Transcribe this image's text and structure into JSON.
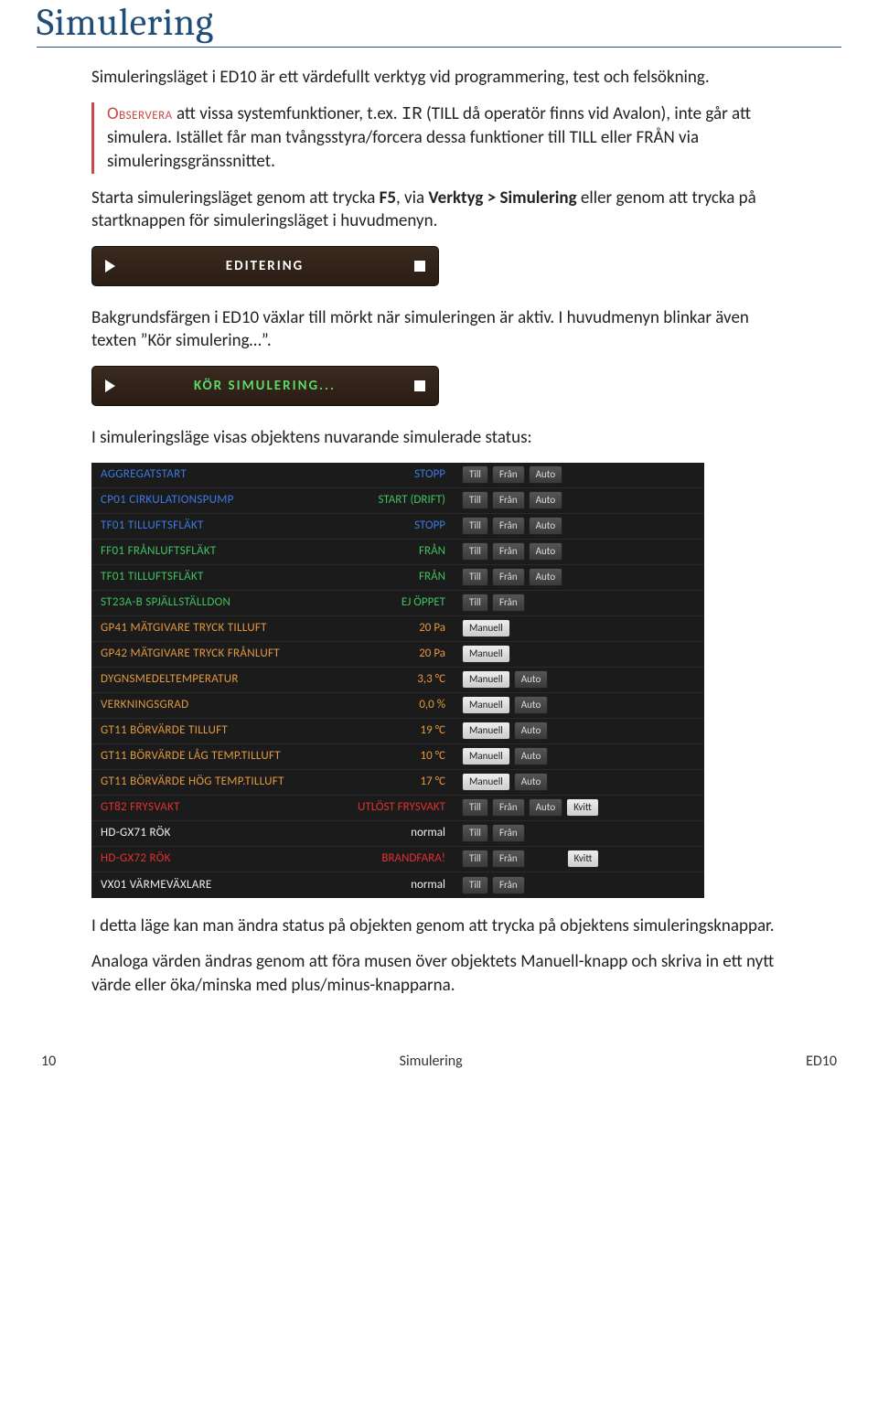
{
  "title": "Simulering",
  "intro": "Simuleringsläget i ED10 är ett värdefullt verktyg vid programmering, test och felsökning.",
  "note": {
    "observera": "Observera",
    "before_mono": " att vissa systemfunktioner, t.ex. ",
    "mono": "IR",
    "after_mono": " (TILL då operatör finns vid Avalon), inte går att simulera. Istället får man tvångsstyra/forcera dessa funktioner till TILL eller FRÅN via simuleringsgränssnittet."
  },
  "start_text": {
    "pre": "Starta simuleringsläget genom att trycka ",
    "f5": "F5",
    "mid1": ", via ",
    "menu": "Verktyg > Simulering",
    "post": " eller genom att trycka på startknappen för simuleringsläget i huvudmenyn."
  },
  "modebar1_label": "EDITERING",
  "bg_text": "Bakgrundsfärgen i ED10 växlar till mörkt när simuleringen är aktiv. I huvudmenyn blinkar även texten ”Kör simulering…”.",
  "modebar2_label": "KÖR SIMULERING...",
  "status_intro": "I simuleringsläge visas objektens nuvarande simulerade status:",
  "btn_labels": {
    "till": "Till",
    "fran": "Från",
    "auto": "Auto",
    "manuell": "Manuell",
    "kvitt": "Kvitt"
  },
  "rows": [
    {
      "name": "AGGREGATSTART",
      "name_c": "c-blue",
      "val": "STOPP",
      "val_c": "c-blue",
      "btns": [
        "till",
        "fran",
        "auto"
      ]
    },
    {
      "name": "CP01 CIRKULATIONSPUMP",
      "name_c": "c-blue",
      "val": "START (DRIFT)",
      "val_c": "c-green",
      "btns": [
        "till",
        "fran",
        "auto"
      ]
    },
    {
      "name": "TF01 TILLUFTSFLÄKT",
      "name_c": "c-blue",
      "val": "STOPP",
      "val_c": "c-blue",
      "btns": [
        "till",
        "fran",
        "auto"
      ]
    },
    {
      "name": "FF01 FRÅNLUFTSFLÄKT",
      "name_c": "c-green",
      "val": "FRÅN",
      "val_c": "c-green",
      "btns": [
        "till",
        "fran",
        "auto"
      ]
    },
    {
      "name": "TF01 TILLUFTSFLÄKT",
      "name_c": "c-green",
      "val": "FRÅN",
      "val_c": "c-green",
      "btns": [
        "till",
        "fran",
        "auto"
      ]
    },
    {
      "name": "ST23A-B SPJÄLLSTÄLLDON",
      "name_c": "c-green",
      "val": "EJ ÖPPET",
      "val_c": "c-green",
      "btns": [
        "till",
        "fran"
      ]
    },
    {
      "name": "GP41 MÄTGIVARE TRYCK TILLUFT",
      "name_c": "c-orange",
      "val": "20 Pa",
      "val_c": "c-orange",
      "btns": [
        "manuell_l"
      ]
    },
    {
      "name": "GP42 MÄTGIVARE TRYCK FRÅNLUFT",
      "name_c": "c-orange",
      "val": "20 Pa",
      "val_c": "c-orange",
      "btns": [
        "manuell_l"
      ]
    },
    {
      "name": "DYGNSMEDELTEMPERATUR",
      "name_c": "c-orange",
      "val": "3,3 °C",
      "val_c": "c-orange",
      "btns": [
        "manuell_l",
        "auto"
      ]
    },
    {
      "name": "VERKNINGSGRAD",
      "name_c": "c-orange",
      "val": "0,0 %",
      "val_c": "c-orange",
      "btns": [
        "manuell_l",
        "auto"
      ]
    },
    {
      "name": "GT11 BÖRVÄRDE TILLUFT",
      "name_c": "c-orange",
      "val": "19 °C",
      "val_c": "c-orange",
      "btns": [
        "manuell_l",
        "auto"
      ]
    },
    {
      "name": "GT11 BÖRVÄRDE LÅG TEMP.TILLUFT",
      "name_c": "c-orange",
      "val": "10 °C",
      "val_c": "c-orange",
      "btns": [
        "manuell_l",
        "auto"
      ]
    },
    {
      "name": "GT11 BÖRVÄRDE HÖG TEMP.TILLUFT",
      "name_c": "c-orange",
      "val": "17 °C",
      "val_c": "c-orange",
      "btns": [
        "manuell_l",
        "auto"
      ]
    },
    {
      "name": "GT82 FRYSVAKT",
      "name_c": "c-red",
      "val": "UTLÖST FRYSVAKT",
      "val_c": "c-red",
      "btns": [
        "till",
        "fran",
        "auto",
        "kvitt_l"
      ]
    },
    {
      "name": "HD-GX71 RÖK",
      "name_c": "c-white",
      "val": "normal",
      "val_c": "c-white",
      "btns": [
        "till",
        "fran"
      ]
    },
    {
      "name": "HD-GX72 RÖK",
      "name_c": "c-red",
      "val": "BRANDFARA!",
      "val_c": "c-red",
      "btns": [
        "till",
        "fran",
        "",
        "kvitt_l"
      ]
    },
    {
      "name": "VX01 VÄRMEVÄXLARE",
      "name_c": "c-white",
      "val": "normal",
      "val_c": "c-white",
      "btns": [
        "till",
        "fran"
      ]
    }
  ],
  "outro1": "I detta läge kan man ändra status på objekten genom att trycka på objektens simuleringsknappar.",
  "outro2": "Analoga värden ändras genom att föra musen över objektets Manuell-knapp och skriva in ett nytt värde eller öka/minska med plus/minus-knapparna.",
  "footer": {
    "page": "10",
    "center": "Simulering",
    "right": "ED10"
  }
}
